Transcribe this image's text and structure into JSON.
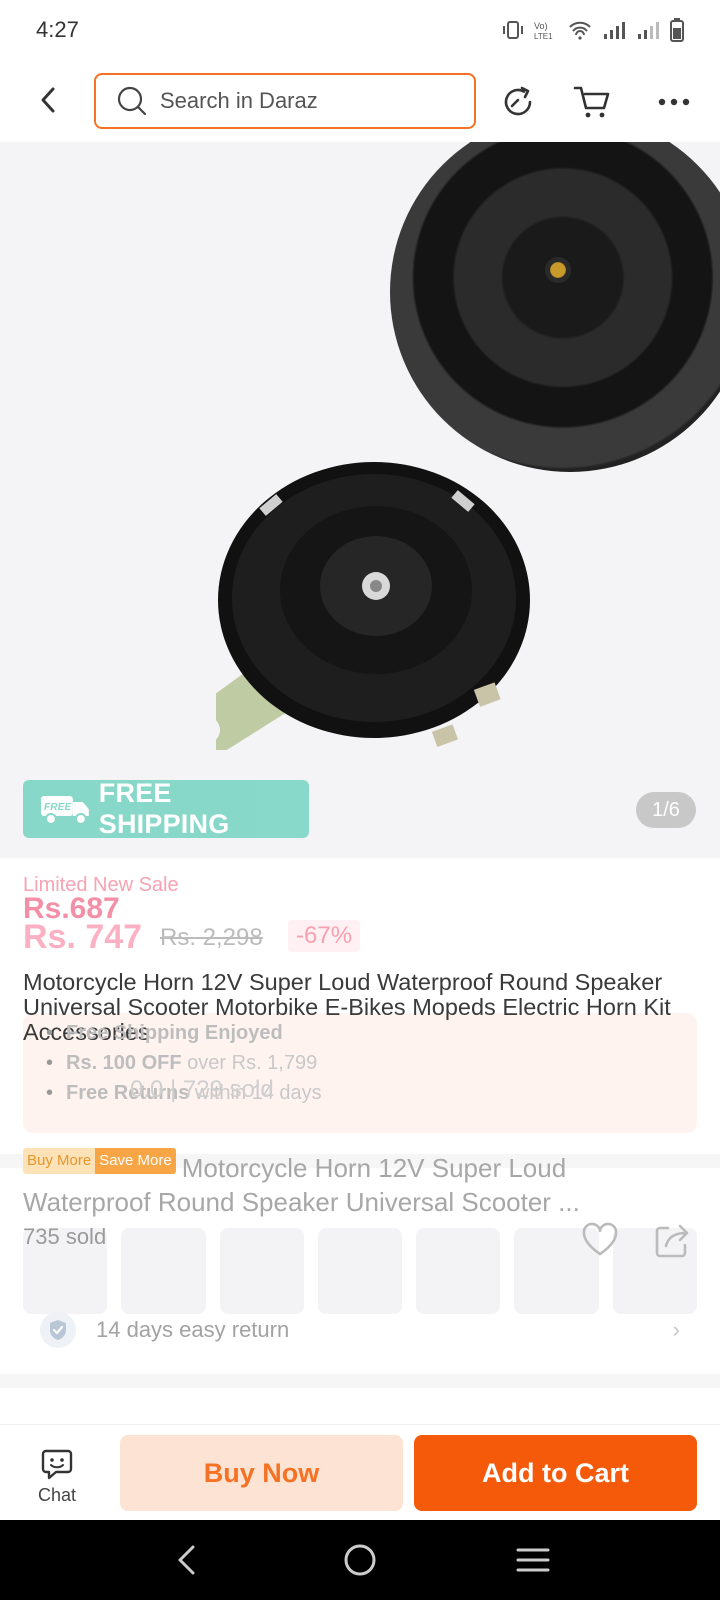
{
  "status_bar": {
    "time": "4:27"
  },
  "header": {
    "search_placeholder": "Search in Daraz"
  },
  "gallery": {
    "badge_text": "FREE SHIPPING",
    "badge_tag": "FREE",
    "page_indicator": "1/6"
  },
  "product": {
    "flash_label": "Limited New Sale",
    "price_sale": "Rs.687",
    "price_now": "Rs. 747",
    "price_original": "Rs. 2,298",
    "discount": "-67%",
    "title": "Motorcycle Horn 12V Super Loud Waterproof Round Speaker Universal Scooter Motorbike E-Bikes Mopeds Electric Horn Kit Accessories",
    "benefits": [
      {
        "label": "Free Shipping Enjoyed",
        "rest": ""
      },
      {
        "label": "Rs. 100 OFF",
        "rest": " over Rs. 1,799"
      },
      {
        "label": "Free Returns",
        "rest": " within 14 days"
      }
    ],
    "rating_line": "0.0  |  729 sold",
    "promo_badge_a": "Buy More",
    "promo_badge_b": "Save More",
    "promo_title": "Motorcycle Horn 12V Super Loud Waterproof Round Speaker Universal Scooter ...",
    "sold": "735 sold",
    "returns": "14 days easy return"
  },
  "actions": {
    "chat": "Chat",
    "buy_now": "Buy Now",
    "add_to_cart": "Add to Cart"
  },
  "colors": {
    "accent": "#f57224",
    "cart_button": "#f55a0a",
    "free_shipping": "#7fd6c6"
  }
}
